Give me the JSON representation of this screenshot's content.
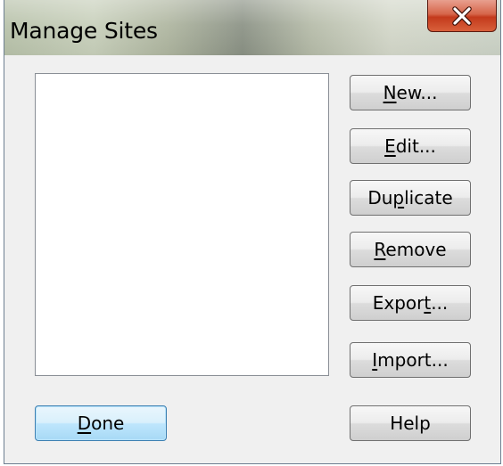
{
  "window": {
    "title": "Manage Sites",
    "close_icon": "close-icon"
  },
  "site_list": {
    "items": []
  },
  "buttons": {
    "new": {
      "pre": "",
      "mnemonic": "N",
      "post": "ew..."
    },
    "edit": {
      "pre": "",
      "mnemonic": "E",
      "post": "dit..."
    },
    "duplicate": {
      "pre": "Du",
      "mnemonic": "p",
      "post": "licate"
    },
    "remove": {
      "pre": "",
      "mnemonic": "R",
      "post": "emove"
    },
    "export": {
      "pre": "Expor",
      "mnemonic": "t",
      "post": "..."
    },
    "import": {
      "pre": "",
      "mnemonic": "I",
      "post": "mport..."
    },
    "done": {
      "pre": "",
      "mnemonic": "D",
      "post": "one"
    },
    "help": {
      "pre": "Help",
      "mnemonic": "",
      "post": ""
    }
  },
  "colors": {
    "close_button": "#c9432a",
    "default_button_border": "#3c7fb1",
    "dialog_background": "#f0f0f0"
  }
}
